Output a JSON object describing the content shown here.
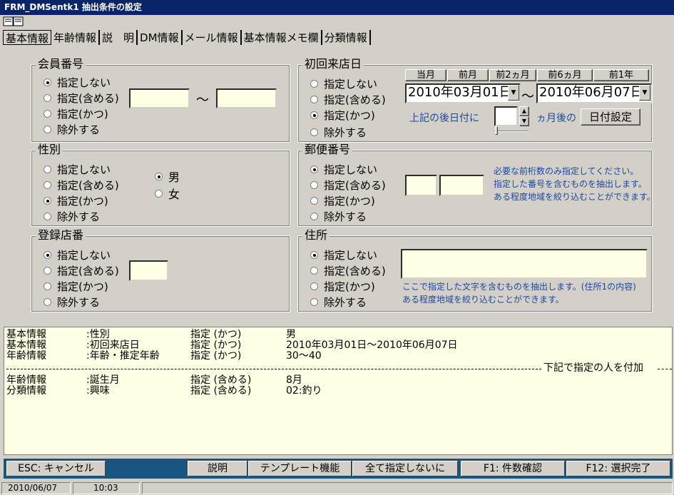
{
  "window": {
    "title": "FRM_DMSentk1 抽出条件の設定"
  },
  "tabs": [
    "基本情報",
    "年齢情報",
    "説　明",
    "DM情報",
    "メール情報",
    "基本情報メモ欄",
    "分類情報"
  ],
  "groups": {
    "member_no": {
      "title": "会員番号",
      "options": [
        "指定しない",
        "指定(含める)",
        "指定(かつ)",
        "除外する"
      ],
      "tilde": "～"
    },
    "first_visit": {
      "title": "初回来店日",
      "options": [
        "指定しない",
        "指定(含める)",
        "指定(かつ)",
        "除外する"
      ],
      "quick_buttons": [
        "当月",
        "前月",
        "前2ヵ月",
        "前6ヵ月",
        "前1年"
      ],
      "date_from": "2010年03月01日",
      "date_to": "2010年06月07日",
      "tilde": "～",
      "after_label": "上記の後日付に",
      "months_label": "ヵ月後の",
      "set_date_button": "日付設定"
    },
    "gender": {
      "title": "性別",
      "options": [
        "指定しない",
        "指定(含める)",
        "指定(かつ)",
        "除外する"
      ],
      "male": "男",
      "female": "女"
    },
    "postal": {
      "title": "郵便番号",
      "options": [
        "指定しない",
        "指定(含める)",
        "指定(かつ)",
        "除外する"
      ],
      "note1": "必要な前桁数のみ指定してください。",
      "note2": "指定した番号を含むものを抽出します。",
      "note3": "ある程度地域を絞り込むことができます。"
    },
    "store": {
      "title": "登録店番",
      "options": [
        "指定しない",
        "指定(含める)",
        "指定(かつ)",
        "除外する"
      ]
    },
    "address": {
      "title": "住所",
      "options": [
        "指定しない",
        "指定(含める)",
        "指定(かつ)",
        "除外する"
      ],
      "note1": "ここで指定した文字を含むものを抽出します。(住所1の内容)",
      "note2": "ある程度地域を絞り込むことができます。"
    }
  },
  "summary": {
    "rows": [
      [
        "基本情報",
        ":性別",
        "指定 (かつ)",
        "男"
      ],
      [
        "基本情報",
        ":初回来店日",
        "指定 (かつ)",
        "2010年03月01日～2010年06月07日"
      ],
      [
        "年齢情報",
        ":年齢・推定年齢",
        "指定 (かつ)",
        "30～40"
      ]
    ],
    "separator": "下記で指定の人を付加",
    "rows2": [
      [
        "年齢情報",
        ":誕生月",
        "指定 (含める)",
        "8月"
      ],
      [
        "分類情報",
        ":興味",
        "指定 (含める)",
        "02:釣り"
      ]
    ]
  },
  "function_buttons": {
    "esc": "ESC: キャンセル",
    "help": "説明",
    "template": "テンプレート機能",
    "all_none": "全て指定しないに",
    "f1": "F1: 件数確認",
    "f12": "F12: 選択完了"
  },
  "status": {
    "date": "2010/06/07",
    "time": "10:03"
  }
}
